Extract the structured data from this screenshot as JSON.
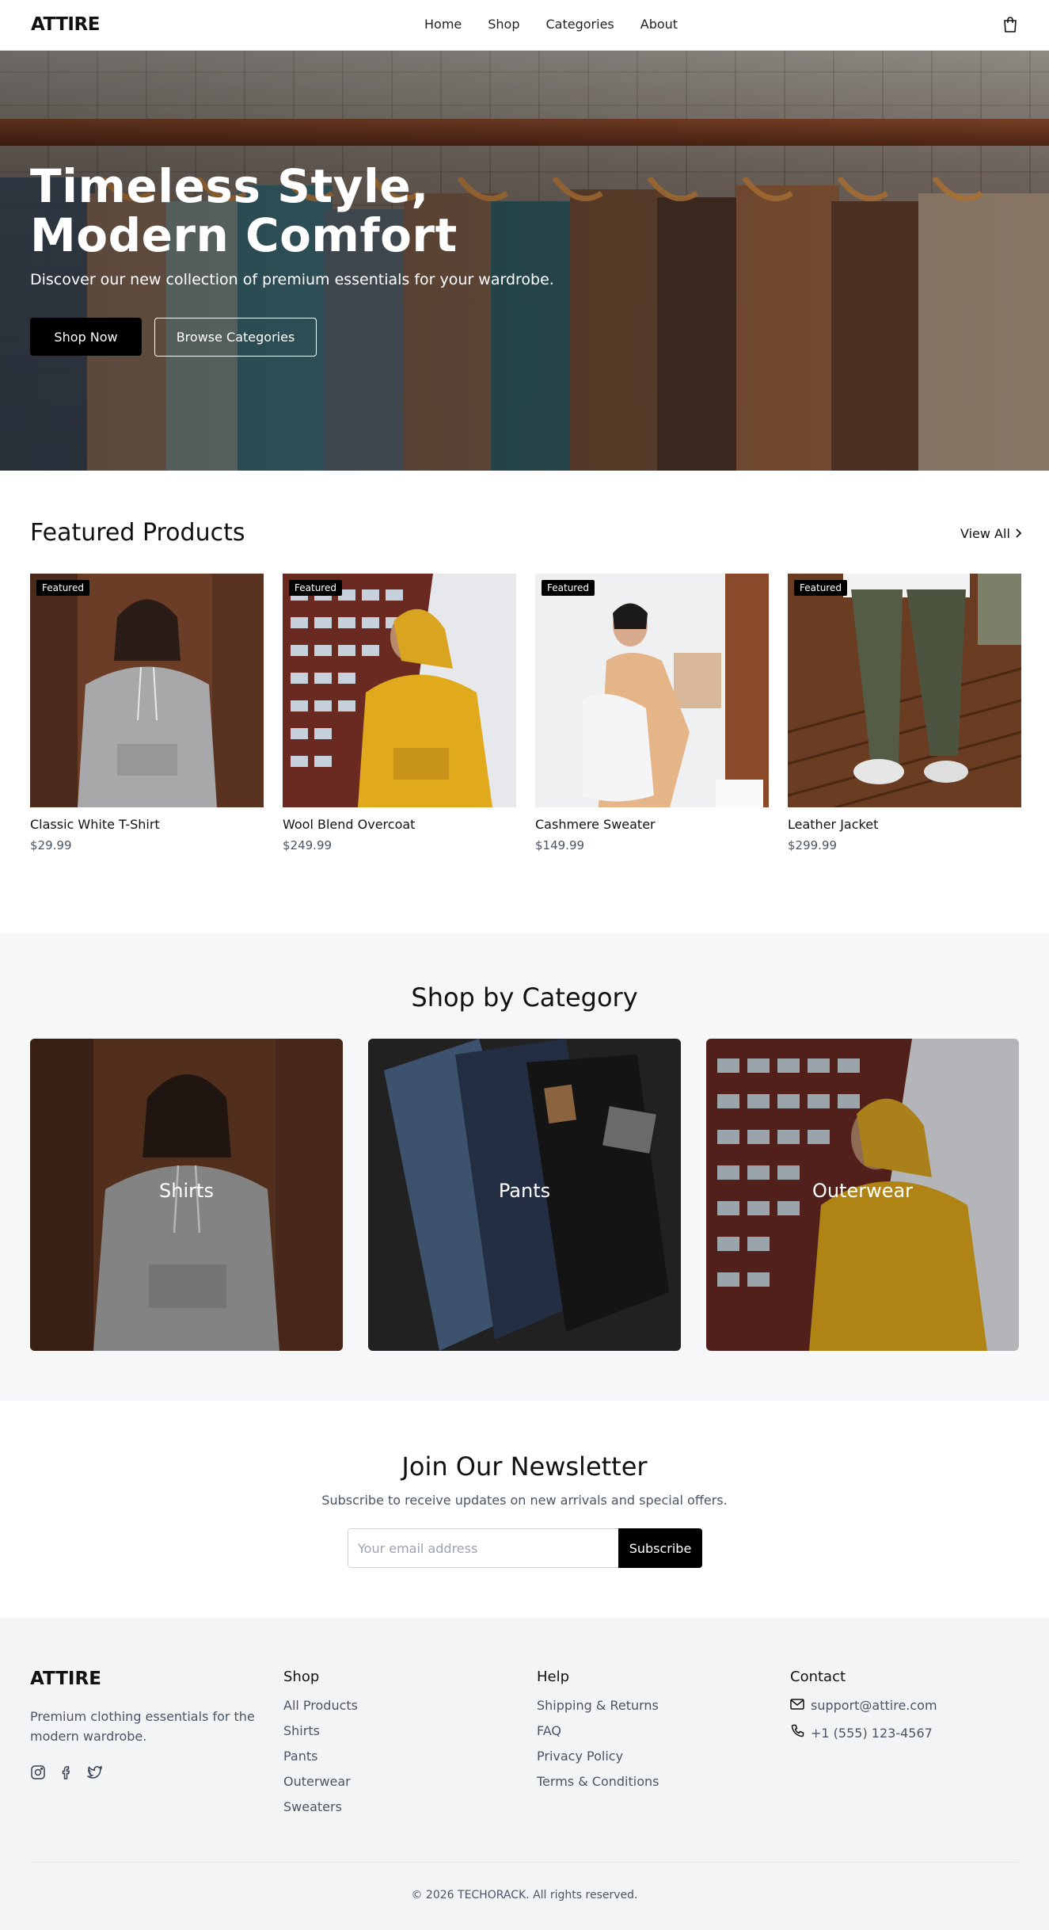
{
  "header": {
    "logo": "ATTIRE",
    "nav": [
      {
        "label": "Home"
      },
      {
        "label": "Shop"
      },
      {
        "label": "Categories"
      },
      {
        "label": "About"
      }
    ],
    "cart_icon": "shopping-bag-icon"
  },
  "hero": {
    "title_line1": "Timeless Style,",
    "title_line2": "Modern Comfort",
    "subtitle": "Discover our new collection of premium essentials for your wardrobe.",
    "primary_button": "Shop Now",
    "secondary_button": "Browse Categories"
  },
  "featured": {
    "title": "Featured Products",
    "view_all": "View All",
    "products": [
      {
        "badge": "Featured",
        "name": "Classic White T-Shirt",
        "price": "$29.99"
      },
      {
        "badge": "Featured",
        "name": "Wool Blend Overcoat",
        "price": "$249.99"
      },
      {
        "badge": "Featured",
        "name": "Cashmere Sweater",
        "price": "$149.99"
      },
      {
        "badge": "Featured",
        "name": "Leather Jacket",
        "price": "$299.99"
      }
    ]
  },
  "categories": {
    "title": "Shop by Category",
    "items": [
      {
        "label": "Shirts"
      },
      {
        "label": "Pants"
      },
      {
        "label": "Outerwear"
      }
    ]
  },
  "newsletter": {
    "title": "Join Our Newsletter",
    "subtitle": "Subscribe to receive updates on new arrivals and special offers.",
    "placeholder": "Your email address",
    "button": "Subscribe"
  },
  "footer": {
    "logo": "ATTIRE",
    "description": "Premium clothing essentials for the modern wardrobe.",
    "social_icons": [
      "instagram-icon",
      "facebook-icon",
      "twitter-icon"
    ],
    "shop": {
      "title": "Shop",
      "links": [
        "All Products",
        "Shirts",
        "Pants",
        "Outerwear",
        "Sweaters"
      ]
    },
    "help": {
      "title": "Help",
      "links": [
        "Shipping & Returns",
        "FAQ",
        "Privacy Policy",
        "Terms & Conditions"
      ]
    },
    "contact": {
      "title": "Contact",
      "email": "support@attire.com",
      "phone": "+1 (555) 123-4567"
    },
    "copyright": "© 2026 TECHORACK. All rights reserved."
  }
}
